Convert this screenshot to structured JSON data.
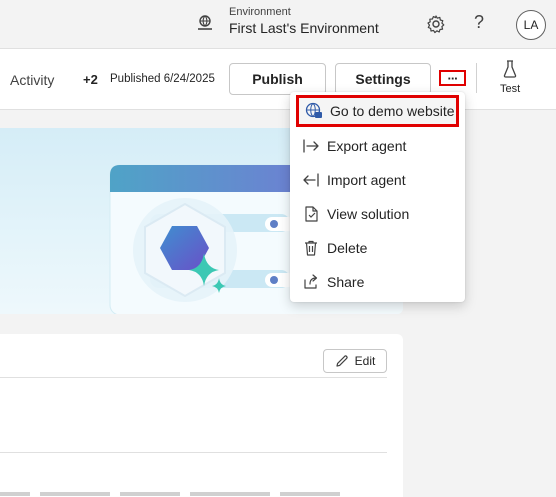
{
  "header": {
    "environment_label": "Environment",
    "environment_name": "First Last's Environment",
    "help_glyph": "?",
    "avatar_initials": "LA"
  },
  "toolbar": {
    "activity_tab": "Activity",
    "extra_count": "+2",
    "published": "Published 6/24/2025",
    "publish_label": "Publish",
    "settings_label": "Settings",
    "more_label": "···",
    "test_label": "Test"
  },
  "menu": {
    "items": [
      {
        "label": "Go to demo website",
        "icon": "globe-icon"
      },
      {
        "label": "Export agent",
        "icon": "export-arrow-icon"
      },
      {
        "label": "Import agent",
        "icon": "import-arrow-icon"
      },
      {
        "label": "View solution",
        "icon": "document-icon"
      },
      {
        "label": "Delete",
        "icon": "trash-icon"
      },
      {
        "label": "Share",
        "icon": "share-icon"
      }
    ]
  },
  "details": {
    "edit_label": "Edit"
  },
  "colors": {
    "highlight": "#e00000",
    "hero_accent": "#5b6fd6",
    "sparkle": "#3cc8b4"
  }
}
